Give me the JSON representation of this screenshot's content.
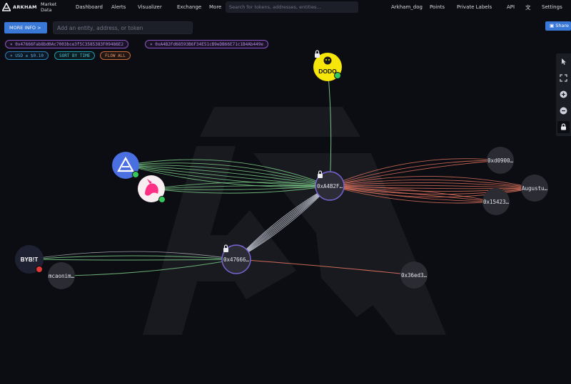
{
  "app": {
    "brand": "ARKHAM",
    "market_data": "Market Data"
  },
  "nav": {
    "dashboard": "Dashboard",
    "alerts": "Alerts",
    "visualizer": "Visualizer",
    "exchange": "Exchange",
    "more": "More",
    "search_placeholder": "Search for tokens, addresses, entities...",
    "user": "Arkham_dog",
    "points": "Points",
    "private_labels": "Private Labels",
    "api": "API",
    "language_icon": "translate-icon",
    "settings": "Settings"
  },
  "controls": {
    "more_info": "MORE INFO >",
    "entity_placeholder": "Add an entity, address, or token",
    "share": "Share",
    "chips": {
      "addr1": "× 0x47666Fab8bd0Ac7003bce3f5C3585383F09486E2",
      "addr2": "× 0xA4B2Fd68593B6F34E51cB9eDB66E71c1B4Ab449e",
      "usd": "× USD ≥ $0.10",
      "sort": "SORT BY TIME",
      "flow": "FLOW ALL"
    }
  },
  "tools": [
    "cursor-icon",
    "fit-screen-icon",
    "zoom-in-icon",
    "zoom-out-icon",
    "lock-icon"
  ],
  "graph": {
    "nodes": {
      "dodo": "DODO",
      "hub": "0xA4B2F…",
      "src": "0x47666…",
      "bybit": "BYB!T",
      "mcaonim": "mcaonim…",
      "d900": "0xd0900…",
      "august": "Augustu…",
      "n15423": "0x15423…",
      "n36ed3": "0x36ed3…"
    },
    "colors": {
      "inflow": "#7fd48c",
      "outflow": "#e0735f",
      "neutral": "#d3d8e4",
      "hub_ring": "#7a64d6"
    }
  }
}
